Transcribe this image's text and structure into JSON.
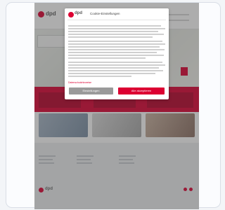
{
  "page": {
    "brand": "dpd",
    "footer_brand": "dpd"
  },
  "modal": {
    "brand": "dpd",
    "title": "Cookie-Einstellungen",
    "privacy_link": "Datenschutzhinweise",
    "settings_button": "Einstellungen",
    "accept_button": "Alle akzeptieren"
  },
  "colors": {
    "brand_red": "#dc0032",
    "overlay": "#3c3c3c",
    "secondary_button": "#9a9a9a"
  },
  "icons": [
    "dpd-logo-icon",
    "facebook-icon",
    "twitter-icon"
  ]
}
